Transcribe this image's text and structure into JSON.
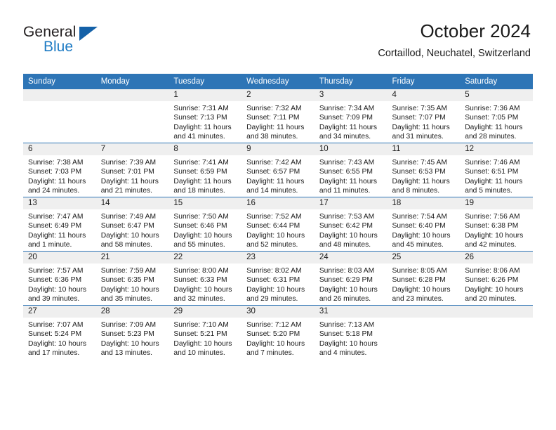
{
  "brand": {
    "name_top": "General",
    "name_bottom": "Blue",
    "triangle_color": "#1461a8",
    "blue_text_color": "#1e7bc4"
  },
  "header": {
    "title": "October 2024",
    "subtitle": "Cortaillod, Neuchatel, Switzerland"
  },
  "colors": {
    "header_blue": "#2e75b6",
    "daynum_band": "#efefef",
    "text": "#1a1a1a"
  },
  "weekday_headers": [
    "Sunday",
    "Monday",
    "Tuesday",
    "Wednesday",
    "Thursday",
    "Friday",
    "Saturday"
  ],
  "labels": {
    "sunrise_prefix": "Sunrise:",
    "sunset_prefix": "Sunset:",
    "daylight_prefix": "Daylight:"
  },
  "weeks": [
    [
      {
        "day": "",
        "empty": true
      },
      {
        "day": "",
        "empty": true
      },
      {
        "day": "1",
        "sunrise": "Sunrise: 7:31 AM",
        "sunset": "Sunset: 7:13 PM",
        "daylight_line1": "Daylight: 11 hours",
        "daylight_line2": "and 41 minutes."
      },
      {
        "day": "2",
        "sunrise": "Sunrise: 7:32 AM",
        "sunset": "Sunset: 7:11 PM",
        "daylight_line1": "Daylight: 11 hours",
        "daylight_line2": "and 38 minutes."
      },
      {
        "day": "3",
        "sunrise": "Sunrise: 7:34 AM",
        "sunset": "Sunset: 7:09 PM",
        "daylight_line1": "Daylight: 11 hours",
        "daylight_line2": "and 34 minutes."
      },
      {
        "day": "4",
        "sunrise": "Sunrise: 7:35 AM",
        "sunset": "Sunset: 7:07 PM",
        "daylight_line1": "Daylight: 11 hours",
        "daylight_line2": "and 31 minutes."
      },
      {
        "day": "5",
        "sunrise": "Sunrise: 7:36 AM",
        "sunset": "Sunset: 7:05 PM",
        "daylight_line1": "Daylight: 11 hours",
        "daylight_line2": "and 28 minutes."
      }
    ],
    [
      {
        "day": "6",
        "sunrise": "Sunrise: 7:38 AM",
        "sunset": "Sunset: 7:03 PM",
        "daylight_line1": "Daylight: 11 hours",
        "daylight_line2": "and 24 minutes."
      },
      {
        "day": "7",
        "sunrise": "Sunrise: 7:39 AM",
        "sunset": "Sunset: 7:01 PM",
        "daylight_line1": "Daylight: 11 hours",
        "daylight_line2": "and 21 minutes."
      },
      {
        "day": "8",
        "sunrise": "Sunrise: 7:41 AM",
        "sunset": "Sunset: 6:59 PM",
        "daylight_line1": "Daylight: 11 hours",
        "daylight_line2": "and 18 minutes."
      },
      {
        "day": "9",
        "sunrise": "Sunrise: 7:42 AM",
        "sunset": "Sunset: 6:57 PM",
        "daylight_line1": "Daylight: 11 hours",
        "daylight_line2": "and 14 minutes."
      },
      {
        "day": "10",
        "sunrise": "Sunrise: 7:43 AM",
        "sunset": "Sunset: 6:55 PM",
        "daylight_line1": "Daylight: 11 hours",
        "daylight_line2": "and 11 minutes."
      },
      {
        "day": "11",
        "sunrise": "Sunrise: 7:45 AM",
        "sunset": "Sunset: 6:53 PM",
        "daylight_line1": "Daylight: 11 hours",
        "daylight_line2": "and 8 minutes."
      },
      {
        "day": "12",
        "sunrise": "Sunrise: 7:46 AM",
        "sunset": "Sunset: 6:51 PM",
        "daylight_line1": "Daylight: 11 hours",
        "daylight_line2": "and 5 minutes."
      }
    ],
    [
      {
        "day": "13",
        "sunrise": "Sunrise: 7:47 AM",
        "sunset": "Sunset: 6:49 PM",
        "daylight_line1": "Daylight: 11 hours",
        "daylight_line2": "and 1 minute."
      },
      {
        "day": "14",
        "sunrise": "Sunrise: 7:49 AM",
        "sunset": "Sunset: 6:47 PM",
        "daylight_line1": "Daylight: 10 hours",
        "daylight_line2": "and 58 minutes."
      },
      {
        "day": "15",
        "sunrise": "Sunrise: 7:50 AM",
        "sunset": "Sunset: 6:46 PM",
        "daylight_line1": "Daylight: 10 hours",
        "daylight_line2": "and 55 minutes."
      },
      {
        "day": "16",
        "sunrise": "Sunrise: 7:52 AM",
        "sunset": "Sunset: 6:44 PM",
        "daylight_line1": "Daylight: 10 hours",
        "daylight_line2": "and 52 minutes."
      },
      {
        "day": "17",
        "sunrise": "Sunrise: 7:53 AM",
        "sunset": "Sunset: 6:42 PM",
        "daylight_line1": "Daylight: 10 hours",
        "daylight_line2": "and 48 minutes."
      },
      {
        "day": "18",
        "sunrise": "Sunrise: 7:54 AM",
        "sunset": "Sunset: 6:40 PM",
        "daylight_line1": "Daylight: 10 hours",
        "daylight_line2": "and 45 minutes."
      },
      {
        "day": "19",
        "sunrise": "Sunrise: 7:56 AM",
        "sunset": "Sunset: 6:38 PM",
        "daylight_line1": "Daylight: 10 hours",
        "daylight_line2": "and 42 minutes."
      }
    ],
    [
      {
        "day": "20",
        "sunrise": "Sunrise: 7:57 AM",
        "sunset": "Sunset: 6:36 PM",
        "daylight_line1": "Daylight: 10 hours",
        "daylight_line2": "and 39 minutes."
      },
      {
        "day": "21",
        "sunrise": "Sunrise: 7:59 AM",
        "sunset": "Sunset: 6:35 PM",
        "daylight_line1": "Daylight: 10 hours",
        "daylight_line2": "and 35 minutes."
      },
      {
        "day": "22",
        "sunrise": "Sunrise: 8:00 AM",
        "sunset": "Sunset: 6:33 PM",
        "daylight_line1": "Daylight: 10 hours",
        "daylight_line2": "and 32 minutes."
      },
      {
        "day": "23",
        "sunrise": "Sunrise: 8:02 AM",
        "sunset": "Sunset: 6:31 PM",
        "daylight_line1": "Daylight: 10 hours",
        "daylight_line2": "and 29 minutes."
      },
      {
        "day": "24",
        "sunrise": "Sunrise: 8:03 AM",
        "sunset": "Sunset: 6:29 PM",
        "daylight_line1": "Daylight: 10 hours",
        "daylight_line2": "and 26 minutes."
      },
      {
        "day": "25",
        "sunrise": "Sunrise: 8:05 AM",
        "sunset": "Sunset: 6:28 PM",
        "daylight_line1": "Daylight: 10 hours",
        "daylight_line2": "and 23 minutes."
      },
      {
        "day": "26",
        "sunrise": "Sunrise: 8:06 AM",
        "sunset": "Sunset: 6:26 PM",
        "daylight_line1": "Daylight: 10 hours",
        "daylight_line2": "and 20 minutes."
      }
    ],
    [
      {
        "day": "27",
        "sunrise": "Sunrise: 7:07 AM",
        "sunset": "Sunset: 5:24 PM",
        "daylight_line1": "Daylight: 10 hours",
        "daylight_line2": "and 17 minutes."
      },
      {
        "day": "28",
        "sunrise": "Sunrise: 7:09 AM",
        "sunset": "Sunset: 5:23 PM",
        "daylight_line1": "Daylight: 10 hours",
        "daylight_line2": "and 13 minutes."
      },
      {
        "day": "29",
        "sunrise": "Sunrise: 7:10 AM",
        "sunset": "Sunset: 5:21 PM",
        "daylight_line1": "Daylight: 10 hours",
        "daylight_line2": "and 10 minutes."
      },
      {
        "day": "30",
        "sunrise": "Sunrise: 7:12 AM",
        "sunset": "Sunset: 5:20 PM",
        "daylight_line1": "Daylight: 10 hours",
        "daylight_line2": "and 7 minutes."
      },
      {
        "day": "31",
        "sunrise": "Sunrise: 7:13 AM",
        "sunset": "Sunset: 5:18 PM",
        "daylight_line1": "Daylight: 10 hours",
        "daylight_line2": "and 4 minutes."
      },
      {
        "day": "",
        "empty": true
      },
      {
        "day": "",
        "empty": true
      }
    ]
  ]
}
